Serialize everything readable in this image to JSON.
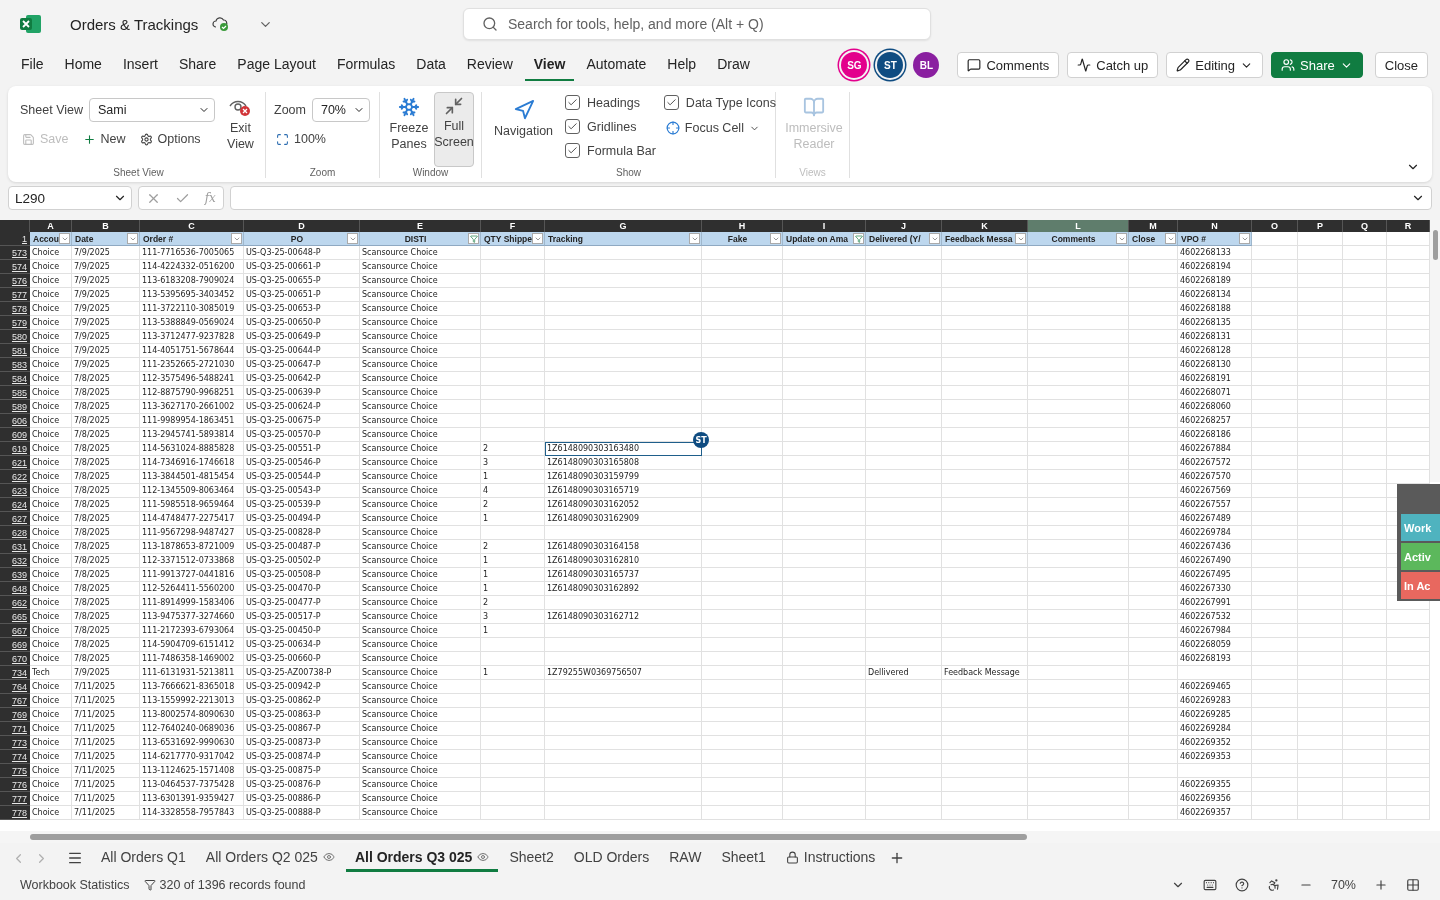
{
  "app": {
    "title": "Orders & Trackings"
  },
  "search": {
    "placeholder": "Search for tools, help, and more (Alt + Q)"
  },
  "menu_tabs": [
    {
      "label": "File",
      "selected": false
    },
    {
      "label": "Home",
      "selected": false
    },
    {
      "label": "Insert",
      "selected": false
    },
    {
      "label": "Share",
      "selected": false
    },
    {
      "label": "Page Layout",
      "selected": false
    },
    {
      "label": "Formulas",
      "selected": false
    },
    {
      "label": "Data",
      "selected": false
    },
    {
      "label": "Review",
      "selected": false
    },
    {
      "label": "View",
      "selected": true
    },
    {
      "label": "Automate",
      "selected": false
    },
    {
      "label": "Help",
      "selected": false
    },
    {
      "label": "Draw",
      "selected": false
    }
  ],
  "collaborators": [
    {
      "initials": "SG",
      "color": "#e3008c"
    },
    {
      "initials": "ST",
      "color": "#0f4c81"
    },
    {
      "initials": "BL",
      "color": "#8a1fa0"
    }
  ],
  "header_buttons": [
    {
      "kind": "comments",
      "label": "Comments"
    },
    {
      "kind": "catchup",
      "label": "Catch up"
    },
    {
      "kind": "editing",
      "label": "Editing"
    },
    {
      "kind": "share",
      "label": "Share"
    },
    {
      "kind": "close",
      "label": "Close"
    }
  ],
  "ribbon": {
    "sheet_view": {
      "caption": "Sheet View",
      "label": "Sheet View",
      "value": "Sami",
      "save": {
        "label": "Save",
        "disabled": true
      },
      "new": "New",
      "options": "Options",
      "exit": "Exit View"
    },
    "zoom": {
      "caption": "Zoom",
      "label": "Zoom",
      "value": "70%",
      "reset": "100%"
    },
    "window": {
      "caption": "Window",
      "freeze": "Freeze Panes",
      "full_screen": {
        "label": "Full Screen",
        "selected": true
      }
    },
    "show": {
      "caption": "Show",
      "navigation": "Navigation",
      "checks": [
        {
          "label": "Headings",
          "checked": true
        },
        {
          "label": "Gridlines",
          "checked": true
        },
        {
          "label": "Formula Bar",
          "checked": true
        },
        {
          "label": "Data Type Icons",
          "checked": true
        }
      ],
      "focus_cell": "Focus Cell"
    },
    "views": {
      "caption": "Views",
      "immersive": "Immersive Reader",
      "disabled": true
    }
  },
  "formula_bar": {
    "name_box": "L290",
    "fx_label": "fx"
  },
  "grid": {
    "corner_row": "1",
    "columns": [
      {
        "letter": "A",
        "selected": false
      },
      {
        "letter": "B",
        "selected": false
      },
      {
        "letter": "C",
        "selected": false
      },
      {
        "letter": "D",
        "selected": false
      },
      {
        "letter": "E",
        "selected": false
      },
      {
        "letter": "F",
        "selected": false
      },
      {
        "letter": "G",
        "selected": false
      },
      {
        "letter": "H",
        "selected": false
      },
      {
        "letter": "I",
        "selected": false
      },
      {
        "letter": "J",
        "selected": false
      },
      {
        "letter": "K",
        "selected": false
      },
      {
        "letter": "L",
        "selected": true
      },
      {
        "letter": "M",
        "selected": false
      },
      {
        "letter": "N",
        "selected": false
      },
      {
        "letter": "O",
        "selected": false
      },
      {
        "letter": "P",
        "selected": false
      },
      {
        "letter": "Q",
        "selected": false
      },
      {
        "letter": "R",
        "selected": false
      }
    ],
    "headers": [
      {
        "label": "Accou",
        "filtered": false
      },
      {
        "label": "Date",
        "filtered": false
      },
      {
        "label": "Order #",
        "filtered": false
      },
      {
        "label": "PO",
        "filtered": false
      },
      {
        "label": "DISTI",
        "filtered": true
      },
      {
        "label": "QTY Shippe",
        "filtered": false
      },
      {
        "label": "Tracking",
        "filtered": false
      },
      {
        "label": "Fake",
        "filtered": false
      },
      {
        "label": "Update on Ama",
        "filtered": true
      },
      {
        "label": "Delivered (Y/",
        "filtered": false
      },
      {
        "label": "Feedback Messa",
        "filtered": false
      },
      {
        "label": "Comments",
        "filtered": false
      },
      {
        "label": "Close",
        "filtered": false
      },
      {
        "label": "VPO #",
        "filtered": false
      }
    ],
    "cursor_badge": "ST",
    "rows": [
      {
        "row": "573",
        "selected": false,
        "account": "Choice",
        "date": "7/9/2025",
        "order": "111-7716536-7005065",
        "po": "US-Q3-25-00648-P",
        "disti": "Scansource Choice",
        "vpo": "4602268133"
      },
      {
        "row": "574",
        "selected": false,
        "account": "Choice",
        "date": "7/9/2025",
        "order": "114-4224332-0516200",
        "po": "US-Q3-25-00661-P",
        "disti": "Scansource Choice",
        "vpo": "4602268194"
      },
      {
        "row": "576",
        "selected": false,
        "account": "Choice",
        "date": "7/9/2025",
        "order": "113-6183208-7909024",
        "po": "US-Q3-25-00655-P",
        "disti": "Scansource Choice",
        "vpo": "4602268189"
      },
      {
        "row": "577",
        "selected": false,
        "account": "Choice",
        "date": "7/9/2025",
        "order": "113-5395695-3403452",
        "po": "US-Q3-25-00651-P",
        "disti": "Scansource Choice",
        "vpo": "4602268134"
      },
      {
        "row": "578",
        "selected": false,
        "account": "Choice",
        "date": "7/9/2025",
        "order": "111-3722110-3085019",
        "po": "US-Q3-25-00653-P",
        "disti": "Scansource Choice",
        "vpo": "4602268188"
      },
      {
        "row": "579",
        "selected": false,
        "account": "Choice",
        "date": "7/9/2025",
        "order": "113-5388849-0569024",
        "po": "US-Q3-25-00650-P",
        "disti": "Scansource Choice",
        "vpo": "4602268135"
      },
      {
        "row": "580",
        "selected": false,
        "account": "Choice",
        "date": "7/9/2025",
        "order": "113-3712477-9237828",
        "po": "US-Q3-25-00649-P",
        "disti": "Scansource Choice",
        "vpo": "4602268131"
      },
      {
        "row": "581",
        "selected": false,
        "account": "Choice",
        "date": "7/9/2025",
        "order": "114-4051751-5678644",
        "po": "US-Q3-25-00644-P",
        "disti": "Scansource Choice",
        "vpo": "4602268128"
      },
      {
        "row": "583",
        "selected": false,
        "account": "Choice",
        "date": "7/9/2025",
        "order": "111-2352665-2721030",
        "po": "US-Q3-25-00647-P",
        "disti": "Scansource Choice",
        "vpo": "4602268130"
      },
      {
        "row": "584",
        "selected": false,
        "account": "Choice",
        "date": "7/8/2025",
        "order": "112-3575496-5488241",
        "po": "US-Q3-25-00642-P",
        "disti": "Scansource Choice",
        "vpo": "4602268191"
      },
      {
        "row": "585",
        "selected": false,
        "account": "Choice",
        "date": "7/8/2025",
        "order": "112-8875790-9968251",
        "po": "US-Q3-25-00639-P",
        "disti": "Scansource Choice",
        "vpo": "4602268071"
      },
      {
        "row": "589",
        "selected": false,
        "account": "Choice",
        "date": "7/8/2025",
        "order": "113-3627170-2661002",
        "po": "US-Q3-25-00624-P",
        "disti": "Scansource Choice",
        "vpo": "4602268060"
      },
      {
        "row": "606",
        "selected": false,
        "account": "Choice",
        "date": "7/8/2025",
        "order": "111-9989954-1863451",
        "po": "US-Q3-25-00675-P",
        "disti": "Scansource Choice",
        "vpo": "4602268257"
      },
      {
        "row": "609",
        "selected": false,
        "account": "Choice",
        "date": "7/8/2025",
        "order": "113-2945741-5893814",
        "po": "US-Q3-25-00570-P",
        "disti": "Scansource Choice",
        "vpo": "4602268186"
      },
      {
        "row": "619",
        "selected": true,
        "account": "Choice",
        "date": "7/8/2025",
        "order": "114-5631024-8885828",
        "po": "US-Q3-25-00551-P",
        "disti": "Scansource Choice",
        "qty": "2",
        "tracking": "1Z6148090303163480",
        "vpo": "4602267884"
      },
      {
        "row": "621",
        "selected": false,
        "account": "Choice",
        "date": "7/8/2025",
        "order": "114-7346916-1746618",
        "po": "US-Q3-25-00546-P",
        "disti": "Scansource Choice",
        "qty": "3",
        "tracking": "1Z6148090303165808",
        "vpo": "4602267572"
      },
      {
        "row": "622",
        "selected": false,
        "account": "Choice",
        "date": "7/8/2025",
        "order": "113-3844501-4815454",
        "po": "US-Q3-25-00544-P",
        "disti": "Scansource Choice",
        "qty": "1",
        "tracking": "1Z6148090303159799",
        "vpo": "4602267570"
      },
      {
        "row": "623",
        "selected": false,
        "account": "Choice",
        "date": "7/8/2025",
        "order": "112-1345509-8063464",
        "po": "US-Q3-25-00543-P",
        "disti": "Scansource Choice",
        "qty": "4",
        "tracking": "1Z6148090303165719",
        "vpo": "4602267569"
      },
      {
        "row": "624",
        "selected": false,
        "account": "Choice",
        "date": "7/8/2025",
        "order": "111-5985518-9659464",
        "po": "US-Q3-25-00539-P",
        "disti": "Scansource Choice",
        "qty": "2",
        "tracking": "1Z6148090303162052",
        "vpo": "4602267557"
      },
      {
        "row": "627",
        "selected": false,
        "account": "Choice",
        "date": "7/8/2025",
        "order": "114-4748477-2275417",
        "po": "US-Q3-25-00494-P",
        "disti": "Scansource Choice",
        "qty": "1",
        "tracking": "1Z6148090303162909",
        "vpo": "4602267489"
      },
      {
        "row": "628",
        "selected": false,
        "account": "Choice",
        "date": "7/8/2025",
        "order": "111-9567298-9487427",
        "po": "US-Q3-25-00828-P",
        "disti": "Scansource Choice",
        "vpo": "4602269784"
      },
      {
        "row": "631",
        "selected": false,
        "account": "Choice",
        "date": "7/8/2025",
        "order": "113-1878653-8721009",
        "po": "US-Q3-25-00487-P",
        "disti": "Scansource Choice",
        "qty": "2",
        "tracking": "1Z6148090303164158",
        "vpo": "4602267436"
      },
      {
        "row": "632",
        "selected": false,
        "account": "Choice",
        "date": "7/8/2025",
        "order": "112-3371512-0733868",
        "po": "US-Q3-25-00502-P",
        "disti": "Scansource Choice",
        "qty": "1",
        "tracking": "1Z6148090303162810",
        "vpo": "4602267490"
      },
      {
        "row": "639",
        "selected": false,
        "account": "Choice",
        "date": "7/8/2025",
        "order": "111-9913727-0441816",
        "po": "US-Q3-25-00508-P",
        "disti": "Scansource Choice",
        "qty": "1",
        "tracking": "1Z6148090303165737",
        "vpo": "4602267495"
      },
      {
        "row": "648",
        "selected": false,
        "account": "Choice",
        "date": "7/8/2025",
        "order": "112-5264411-5560200",
        "po": "US-Q3-25-00470-P",
        "disti": "Scansource Choice",
        "qty": "1",
        "tracking": "1Z6148090303162892",
        "vpo": "4602267330"
      },
      {
        "row": "662",
        "selected": false,
        "account": "Choice",
        "date": "7/8/2025",
        "order": "111-8914999-1583406",
        "po": "US-Q3-25-00477-P",
        "disti": "Scansource Choice",
        "qty": "2",
        "vpo": "4602267991"
      },
      {
        "row": "665",
        "selected": false,
        "account": "Choice",
        "date": "7/8/2025",
        "order": "113-9475377-3274660",
        "po": "US-Q3-25-00517-P",
        "disti": "Scansource Choice",
        "qty": "3",
        "tracking": "1Z6148090303162712",
        "vpo": "4602267532"
      },
      {
        "row": "667",
        "selected": false,
        "account": "Choice",
        "date": "7/8/2025",
        "order": "111-2172393-6793064",
        "po": "US-Q3-25-00450-P",
        "disti": "Scansource Choice",
        "qty": "1",
        "vpo": "4602267984"
      },
      {
        "row": "669",
        "selected": false,
        "account": "Choice",
        "date": "7/8/2025",
        "order": "114-5904709-6151412",
        "po": "US-Q3-25-00634-P",
        "disti": "Scansource Choice",
        "vpo": "4602268059"
      },
      {
        "row": "670",
        "selected": false,
        "account": "Choice",
        "date": "7/8/2025",
        "order": "111-7486358-1469002",
        "po": "US-Q3-25-00660-P",
        "disti": "Scansource Choice",
        "vpo": "4602268193"
      },
      {
        "row": "734",
        "selected": false,
        "account": "Tech",
        "date": "7/9/2025",
        "order": "111-6131931-5213811",
        "po": "US-Q3-25-AZ00738-P",
        "disti": "Scansource Choice",
        "qty": "1",
        "tracking": "1Z79255W0369756507",
        "delivered": "Dellivered",
        "feedback": "Feedback Message"
      },
      {
        "row": "764",
        "selected": false,
        "account": "Choice",
        "date": "7/11/2025",
        "order": "113-7666621-8365018",
        "po": "US-Q3-25-00942-P",
        "disti": "Scansource Choice",
        "vpo": "4602269465"
      },
      {
        "row": "767",
        "selected": false,
        "account": "Choice",
        "date": "7/11/2025",
        "order": "113-1559992-2213013",
        "po": "US-Q3-25-00862-P",
        "disti": "Scansource Choice",
        "vpo": "4602269283"
      },
      {
        "row": "769",
        "selected": false,
        "account": "Choice",
        "date": "7/11/2025",
        "order": "113-8002574-8090630",
        "po": "US-Q3-25-00863-P",
        "disti": "Scansource Choice",
        "vpo": "4602269285"
      },
      {
        "row": "771",
        "selected": false,
        "account": "Choice",
        "date": "7/11/2025",
        "order": "112-7640240-0689036",
        "po": "US-Q3-25-00867-P",
        "disti": "Scansource Choice",
        "vpo": "4602269284"
      },
      {
        "row": "773",
        "selected": false,
        "account": "Choice",
        "date": "7/11/2025",
        "order": "113-6531692-9990630",
        "po": "US-Q3-25-00873-P",
        "disti": "Scansource Choice",
        "vpo": "4602269352"
      },
      {
        "row": "774",
        "selected": false,
        "account": "Choice",
        "date": "7/11/2025",
        "order": "114-6217770-9317042",
        "po": "US-Q3-25-00874-P",
        "disti": "Scansource Choice",
        "vpo": "4602269353"
      },
      {
        "row": "775",
        "selected": false,
        "account": "Choice",
        "date": "7/11/2025",
        "order": "113-1124625-1571408",
        "po": "US-Q3-25-00875-P",
        "disti": "Scansource Choice"
      },
      {
        "row": "776",
        "selected": false,
        "account": "Choice",
        "date": "7/11/2025",
        "order": "113-0464537-7375428",
        "po": "US-Q3-25-00876-P",
        "disti": "Scansource Choice",
        "vpo": "4602269355"
      },
      {
        "row": "777",
        "selected": false,
        "account": "Choice",
        "date": "7/11/2025",
        "order": "113-6301391-9359427",
        "po": "US-Q3-25-00886-P",
        "disti": "Scansource Choice",
        "vpo": "4602269356"
      },
      {
        "row": "778",
        "selected": false,
        "account": "Choice",
        "date": "7/11/2025",
        "order": "114-3328558-7957843",
        "po": "US-Q3-25-00888-P",
        "disti": "Scansource Choice",
        "vpo": "4602269357"
      }
    ]
  },
  "side_panel": [
    {
      "label": "Work",
      "color": "#4fb3bf"
    },
    {
      "label": "Activ",
      "color": "#5cb85c"
    },
    {
      "label": "In Ac",
      "color": "#e8685f"
    }
  ],
  "sheets": [
    {
      "label": "All Orders Q1",
      "kind": "plain",
      "selected": false
    },
    {
      "label": "All Orders Q2 025",
      "kind": "eye",
      "selected": false
    },
    {
      "label": "All Orders Q3 025",
      "kind": "eye",
      "selected": true
    },
    {
      "label": "Sheet2",
      "kind": "plain",
      "selected": false
    },
    {
      "label": "OLD Orders",
      "kind": "plain",
      "selected": false
    },
    {
      "label": "RAW",
      "kind": "plain",
      "selected": false
    },
    {
      "label": "Sheet1",
      "kind": "plain",
      "selected": false
    },
    {
      "label": "Instructions",
      "kind": "lock",
      "selected": false
    }
  ],
  "status_bar": {
    "statistics": "Workbook Statistics",
    "records": "320 of 1396 records found",
    "zoom": "70%"
  }
}
